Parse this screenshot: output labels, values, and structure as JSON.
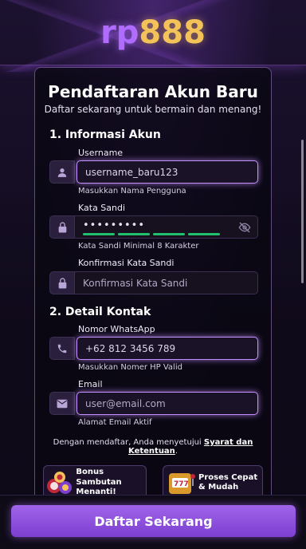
{
  "logo": {
    "part1": "rp",
    "part2": "888"
  },
  "form": {
    "title": "Pendaftaran Akun Baru",
    "subtitle": "Daftar sekarang untuk bermain dan menang!",
    "section1": "1. Informasi Akun",
    "section2": "2. Detail Kontak",
    "username": {
      "label": "Username",
      "value": "username_baru123",
      "hint": "Masukkan Nama Pengguna"
    },
    "password": {
      "label": "Kata Sandi",
      "value": "•••••••••",
      "hint": "Kata Sandi Minimal 8 Karakter",
      "strength": 4
    },
    "confirm": {
      "label": "Konfirmasi Kata Sandi",
      "placeholder": "Konfirmasi Kata Sandi"
    },
    "whatsapp": {
      "label": "Nomor WhatsApp",
      "value": "+62 812 3456 789",
      "hint": "Masukkan Nomer HP Valid"
    },
    "email": {
      "label": "Email",
      "placeholder": "user@email.com",
      "hint": "Alamat Email Aktif"
    },
    "terms_prefix": "Dengan mendaftar, Anda menyetujui ",
    "terms_link": "Syarat dan Ketentuan",
    "terms_suffix": "."
  },
  "promos": [
    {
      "line1": "Bonus Sambutan",
      "line2": "Menanti!",
      "icon": "casino-chips-icon"
    },
    {
      "line1": "Proses Cepat",
      "line2": "& Mudah",
      "icon": "slot-machine-icon"
    }
  ],
  "cta_label": "Daftar Sekarang",
  "colors": {
    "accent": "#a064ea",
    "gold": "#f3c35a",
    "strength": "#22c06e"
  }
}
